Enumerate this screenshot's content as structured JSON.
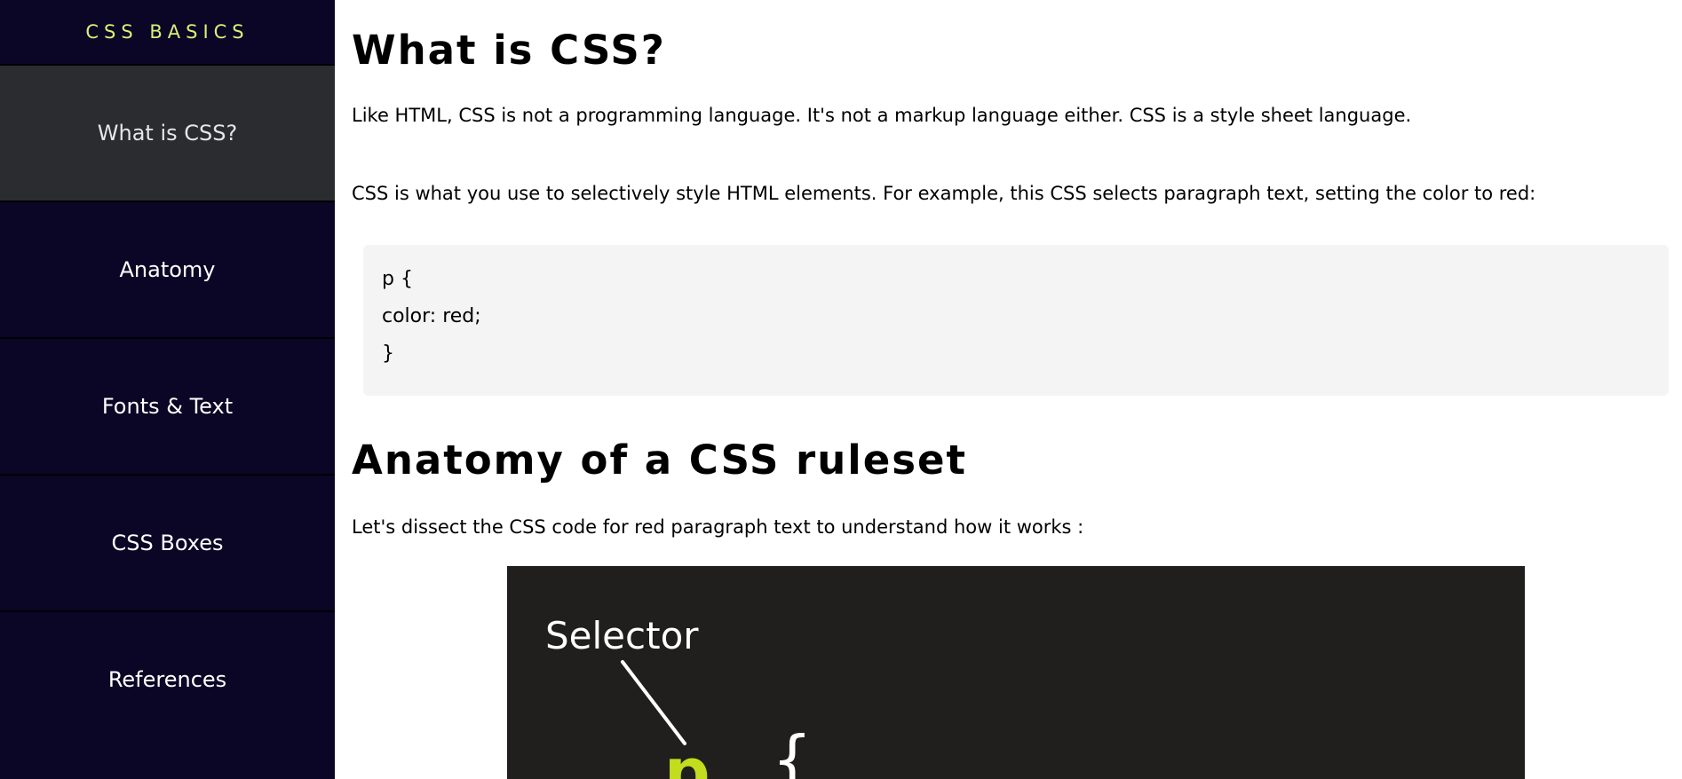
{
  "sidebar": {
    "brand": "CSS BASICS",
    "items": [
      {
        "label": "What is CSS?"
      },
      {
        "label": "Anatomy"
      },
      {
        "label": "Fonts & Text"
      },
      {
        "label": "CSS Boxes"
      },
      {
        "label": "References"
      }
    ]
  },
  "main": {
    "section1": {
      "title": "What is CSS?",
      "para1": "Like HTML, CSS is not a programming language. It's not a markup language either. CSS is a style sheet language.",
      "para2": "CSS is what you use to selectively style HTML elements. For example, this CSS selects paragraph text, setting the color to red:",
      "code": [
        "p {",
        "color: red;",
        "}"
      ]
    },
    "section2": {
      "title": "Anatomy of a CSS ruleset",
      "para1": "Let's dissect the CSS code for red paragraph text to understand how it works :",
      "figure": {
        "label": "Selector",
        "selector_glyph": "p",
        "brace_glyph": "{"
      }
    }
  },
  "colors": {
    "sidebar_bg": "#0b0526",
    "active_bg": "#2b2c30",
    "brand": "#d7f277",
    "selector_accent": "#c2dd1d"
  }
}
